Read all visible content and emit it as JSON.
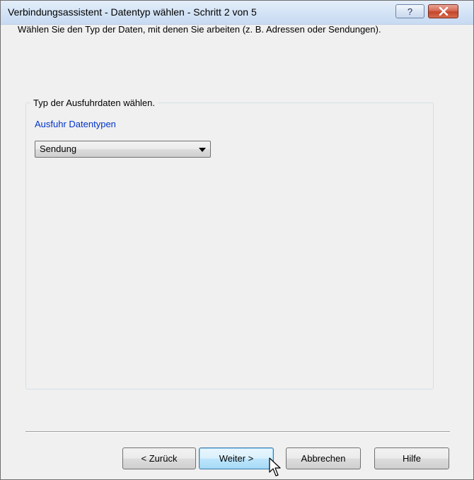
{
  "window": {
    "title": "Verbindungsassistent - Datentyp wählen - Schritt 2 von 5",
    "help_button_label": "?",
    "close_icon": "close-x-icon"
  },
  "main": {
    "intro_text": "Wählen Sie den Typ der Daten, mit denen Sie arbeiten (z. B. Adressen oder Sendungen).",
    "group_title": "Typ der Ausfuhrdaten wählen.",
    "field_label": "Ausfuhr Datentypen",
    "data_type_select": {
      "selected_value": "Sendung"
    }
  },
  "footer": {
    "back_label": "< Zurück",
    "next_label": "Weiter >",
    "cancel_label": "Abbrechen",
    "help_label": "Hilfe"
  },
  "colors": {
    "field_label": "#0033cc",
    "title_bar": "#d6e5f6",
    "close_button": "#c4452a",
    "default_button_border": "#3c7fb1"
  }
}
